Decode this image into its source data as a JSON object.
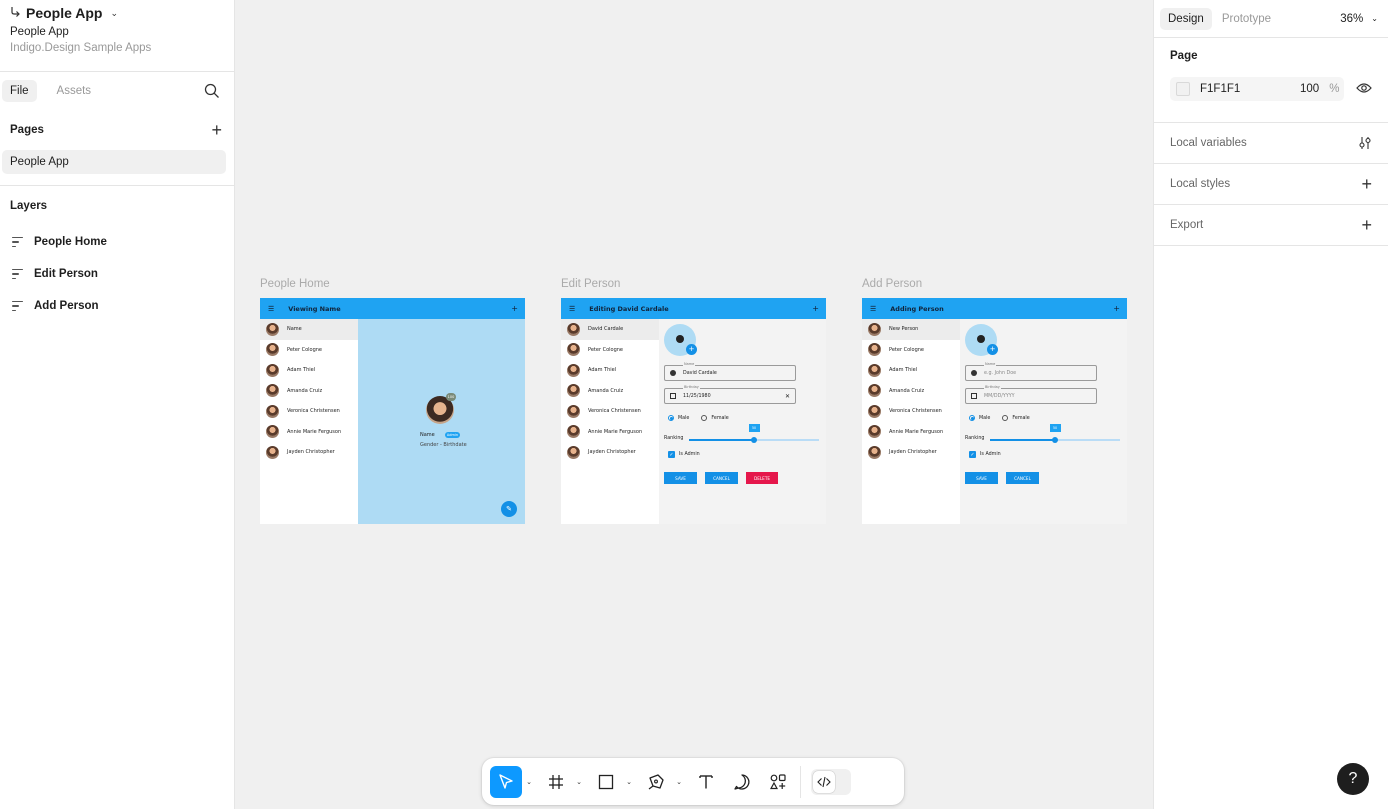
{
  "project": {
    "title": "People App",
    "file_name": "People App",
    "team": "Indigo.Design Sample Apps"
  },
  "left_tabs": {
    "file": "File",
    "assets": "Assets"
  },
  "pages_section": {
    "label": "Pages",
    "items": [
      "People App"
    ]
  },
  "layers_section": {
    "label": "Layers",
    "items": [
      "People Home",
      "Edit Person",
      "Add Person"
    ]
  },
  "right_panel": {
    "tabs": {
      "design": "Design",
      "prototype": "Prototype"
    },
    "zoom": "36%",
    "page_label": "Page",
    "bg_color": "F1F1F1",
    "bg_opacity": "100",
    "pct": "%",
    "sections": [
      "Local variables",
      "Local styles",
      "Export"
    ]
  },
  "help_label": "?",
  "frames": [
    {
      "label": "People Home",
      "bar_title": "Viewing Name",
      "list": [
        "Name",
        "Peter Cologne",
        "Adam Thiel",
        "Amanda Cruiz",
        "Veronica Christensen",
        "Annie Marie Ferguson",
        "Jayden Christopher"
      ],
      "detail_name": "Name",
      "detail_badge": "Admin",
      "detail_sub": "Gender - Birthdate",
      "avatar_badge": "100"
    },
    {
      "label": "Edit Person",
      "bar_title": "Editing David Cardale",
      "list": [
        "David Cardale",
        "Peter Cologne",
        "Adam Thiel",
        "Amanda Cruiz",
        "Veronica Christensen",
        "Annie Marie Ferguson",
        "Jayden Christopher"
      ],
      "name_label": "Name",
      "name_value": "David Cardale",
      "birthday_label": "Birthday",
      "birthday_value": "11/25/1980",
      "male": "Male",
      "female": "Female",
      "ranking": "Ranking",
      "ranking_value": "50",
      "ranking_fraction": 0.5,
      "is_admin": "Is Admin",
      "save": "SAVE",
      "cancel": "CANCEL",
      "delete": "DELETE"
    },
    {
      "label": "Add Person",
      "bar_title": "Adding Person",
      "list": [
        "New Person",
        "Peter Cologne",
        "Adam Thiel",
        "Amanda Cruiz",
        "Veronica Christensen",
        "Annie Marie Ferguson",
        "Jayden Christopher"
      ],
      "name_label": "Name",
      "name_placeholder": "e.g. John Doe",
      "birthday_label": "Birthday",
      "birthday_placeholder": "MM/DD/YYYY",
      "male": "Male",
      "female": "Female",
      "ranking": "Ranking",
      "ranking_value": "50",
      "ranking_fraction": 0.5,
      "is_admin": "Is Admin",
      "save": "SAVE",
      "cancel": "CANCEL"
    }
  ],
  "colors": {
    "accent": "#0d99ff",
    "app_bar": "#1fa3f2",
    "detail_blue": "#aedbf4",
    "delete_red": "#e5174b",
    "canvas": "#f0f0f0"
  },
  "toolbar_icons": [
    "move-tool-icon",
    "frame-tool-icon",
    "rectangle-tool-icon",
    "pen-tool-icon",
    "text-tool-icon",
    "comment-tool-icon",
    "actions-icon",
    "dev-mode-icon"
  ]
}
